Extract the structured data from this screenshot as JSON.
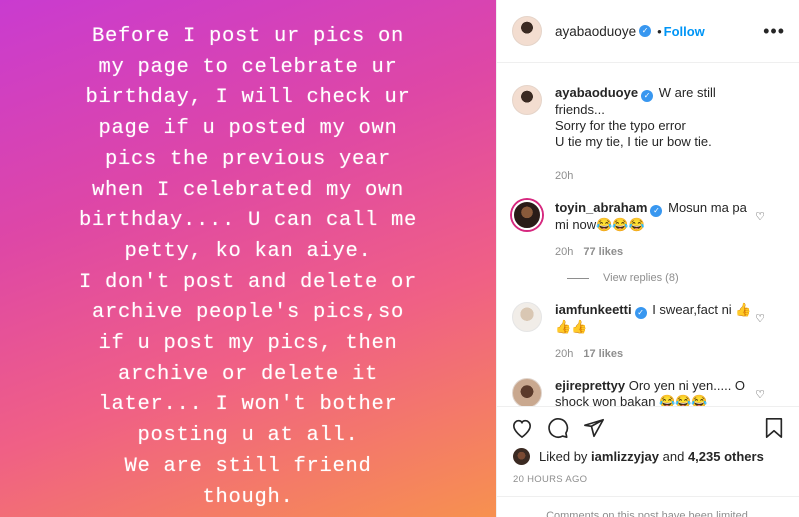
{
  "story": {
    "text": "Before I post ur pics on\nmy page to celebrate ur\nbirthday, I will check ur\npage if u posted my own\npics the previous year\nwhen I celebrated my own\nbirthday.... U can call me\npetty, ko kan aiye.\nI don't post and delete or\narchive people's pics,so\nif u post my pics, then\narchive or delete it\nlater... I won't bother\nposting u at all.\nWe are still friend\nthough."
  },
  "header": {
    "username": "ayabaoduoye",
    "separator": "•",
    "follow_label": "Follow",
    "more_label": "•••"
  },
  "caption": {
    "username": "ayabaoduoye",
    "text_line1": "W are still friends...",
    "text_line2": "Sorry for the typo error",
    "text_line3": "U tie my tie, I tie ur bow tie.",
    "time": "20h"
  },
  "comments": [
    {
      "username": "toyin_abraham",
      "text": "Mosun ma pa mi now😂😂😂",
      "time": "20h",
      "likes": "77 likes",
      "replies": "View replies (8)"
    },
    {
      "username": "iamfunkeetti",
      "text": "I swear,fact ni 👍👍👍",
      "time": "20h",
      "likes": "17 likes"
    },
    {
      "username": "ejireprettyy",
      "text": "Oro yen ni yen..... O shock won bakan 😂😂😂"
    }
  ],
  "likes": {
    "prefix": "Liked by",
    "user": "iamlizzyjay",
    "connector": "and",
    "others": "4,235 others"
  },
  "timestamp": "20 HOURS AGO",
  "footer_text": "Comments on this post have been limited.",
  "colors": {
    "link": "#0095f6",
    "muted": "#8e8e8e",
    "verified": "#3897f0"
  },
  "icons": [
    "heart-icon",
    "comment-icon",
    "share-icon",
    "bookmark-icon",
    "verified-badge-icon",
    "more-icon"
  ]
}
